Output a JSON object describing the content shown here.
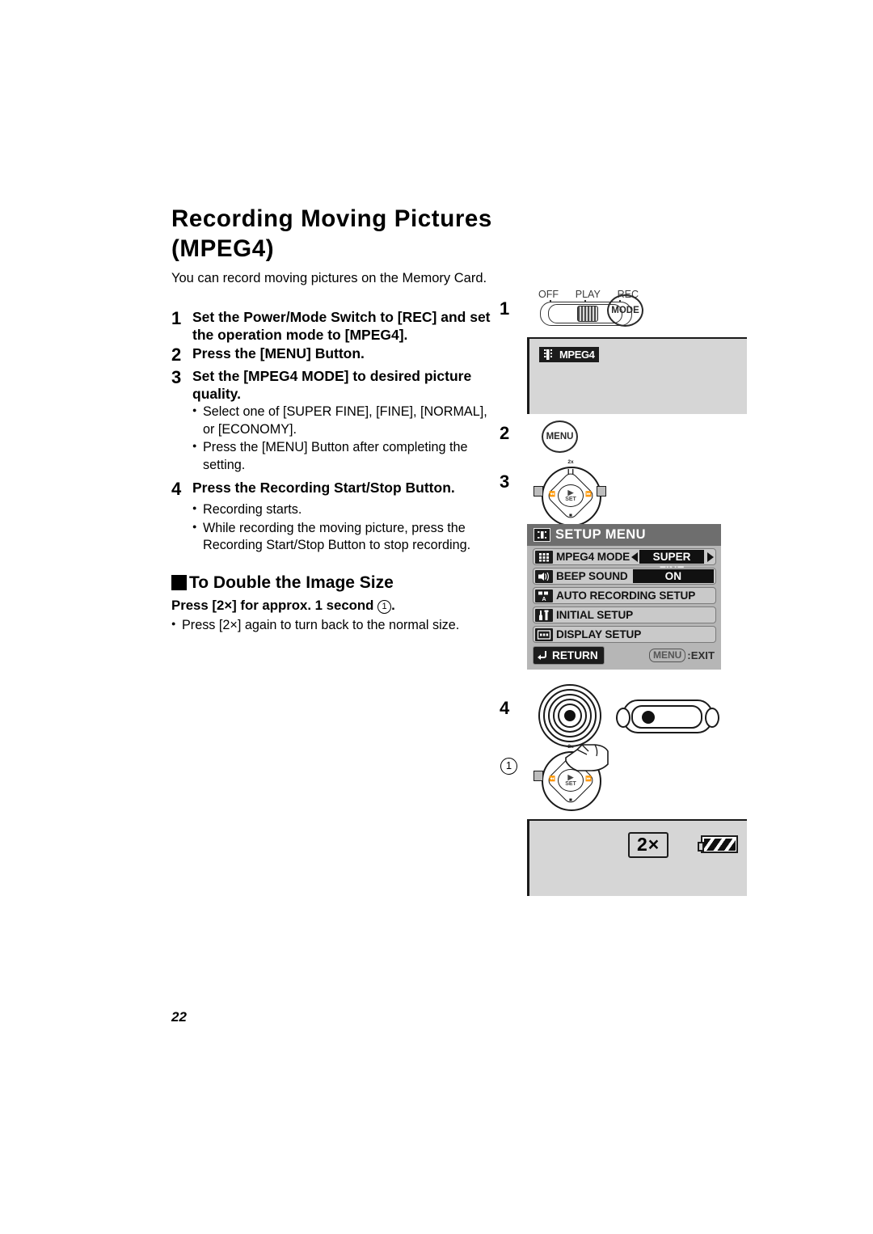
{
  "document": {
    "title_line1": "Recording Moving Pictures",
    "title_line2": "(MPEG4)",
    "intro": "You can record moving pictures on the Memory Card.",
    "page_number": "22"
  },
  "steps": [
    {
      "num": "1",
      "text": "Set the Power/Mode Switch to [REC] and set the operation mode to [MPEG4].",
      "bullets": []
    },
    {
      "num": "2",
      "text": "Press the [MENU] Button.",
      "bullets": []
    },
    {
      "num": "3",
      "text": "Set the [MPEG4 MODE] to desired picture quality.",
      "bullets": [
        "Select one of [SUPER FINE],  [FINE], [NORMAL], or [ECONOMY].",
        "Press the [MENU] Button after completing the setting."
      ]
    },
    {
      "num": "4",
      "text": "Press the Recording Start/Stop Button.",
      "bullets": [
        "Recording starts.",
        "While recording the moving picture, press the Recording Start/Stop Button to stop recording."
      ]
    }
  ],
  "section": {
    "heading": "To Double the Image Size",
    "press_prefix": "Press [2",
    "press_times": "×",
    "press_mid": "] for approx. 1 second ",
    "press_circle": "1",
    "press_suffix": ".",
    "bullet": "Press [2×] again to turn back to the normal size."
  },
  "illustrations": {
    "step_labels": {
      "one": "1",
      "two": "2",
      "three": "3",
      "four": "4",
      "circle_one": "1"
    },
    "power_switch": {
      "label_off": "OFF",
      "label_play": "PLAY",
      "label_rec": "REC"
    },
    "mode_button_label": "MODE",
    "menu_button_label": "MENU",
    "lcd_rec": {
      "badge_text": "MPEG4"
    },
    "lcd_zoom": {
      "zoom_indicator": "2×"
    },
    "dial": {
      "top_label": "2x",
      "pause_label": "❙❙",
      "center_label": "SET",
      "play_label": "▶",
      "left_label": "⏪",
      "right_label": "⏩",
      "stop_label": "■"
    }
  },
  "setup_menu": {
    "title": "SETUP MENU",
    "rows": [
      {
        "label": "MPEG4 MODE",
        "value": "SUPER FINE",
        "has_arrows": true
      },
      {
        "label": "BEEP SOUND",
        "value": "ON",
        "has_arrows": false
      },
      {
        "label": "AUTO RECORDING SETUP",
        "value": "",
        "has_arrows": false
      },
      {
        "label": "INITIAL SETUP",
        "value": "",
        "has_arrows": false
      },
      {
        "label": "DISPLAY SETUP",
        "value": "",
        "has_arrows": false
      }
    ],
    "return_label": "RETURN",
    "exit_chip": "MENU",
    "exit_label": ":EXIT"
  },
  "colors": {
    "lcd_background": "#d6d6d6",
    "menu_background": "#b6b6b6",
    "menu_header": "#6e6e6e",
    "menu_row": "#c9c9c9",
    "value_field": "#111111"
  }
}
